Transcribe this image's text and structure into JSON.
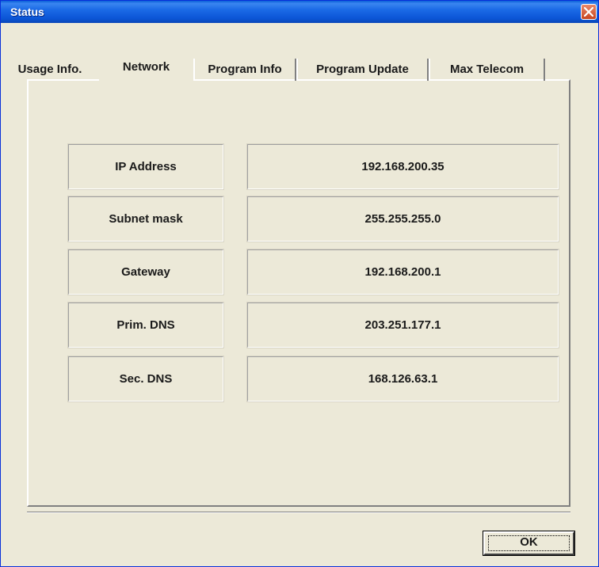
{
  "window": {
    "title": "Status"
  },
  "tabs": [
    {
      "label": "Usage Info.",
      "active": false
    },
    {
      "label": "Network",
      "active": true
    },
    {
      "label": "Program Info",
      "active": false
    },
    {
      "label": "Program Update",
      "active": false
    },
    {
      "label": "Max Telecom",
      "active": false
    }
  ],
  "network": [
    {
      "label": "IP Address",
      "value": "192.168.200.35"
    },
    {
      "label": "Subnet mask",
      "value": "255.255.255.0"
    },
    {
      "label": "Gateway",
      "value": "192.168.200.1"
    },
    {
      "label": "Prim. DNS",
      "value": "203.251.177.1"
    },
    {
      "label": "Sec. DNS",
      "value": "168.126.63.1"
    }
  ],
  "buttons": {
    "ok": "OK"
  },
  "icons": {
    "close": "close-icon"
  },
  "colors": {
    "titlebar": "#0b55d6",
    "background": "#ece9d8",
    "close": "#c94620"
  }
}
